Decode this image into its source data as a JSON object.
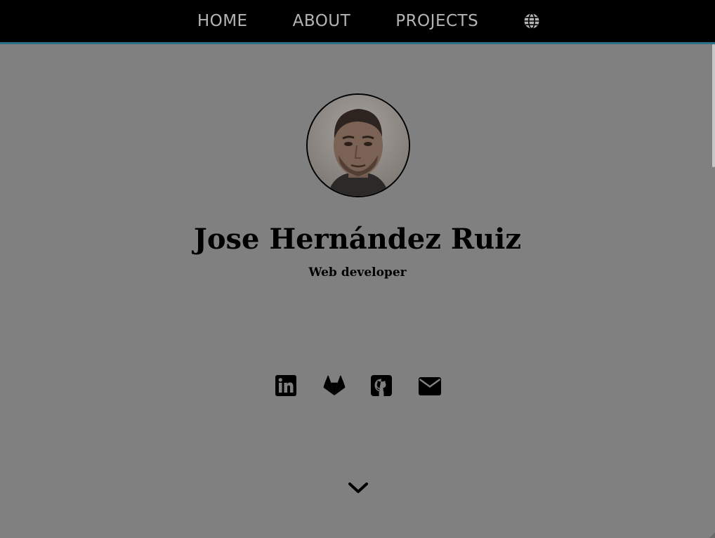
{
  "nav": {
    "items": [
      {
        "label": "HOME"
      },
      {
        "label": "ABOUT"
      },
      {
        "label": "PROJECTS"
      }
    ],
    "language_icon": "globe-icon"
  },
  "profile": {
    "name": "Jose Hernández Ruiz",
    "role": "Web developer",
    "avatar_icon": "profile-photo"
  },
  "social": [
    {
      "name": "linkedin",
      "icon": "linkedin-icon"
    },
    {
      "name": "gitlab",
      "icon": "gitlab-icon"
    },
    {
      "name": "github",
      "icon": "github-icon"
    },
    {
      "name": "email",
      "icon": "envelope-icon"
    }
  ],
  "scroll_icon": "chevron-down-icon",
  "colors": {
    "page_background": "#808080",
    "navbar_background": "#000000",
    "navbar_border": "#2f6f87",
    "nav_text": "#b4b4b4",
    "text": "#000000"
  }
}
